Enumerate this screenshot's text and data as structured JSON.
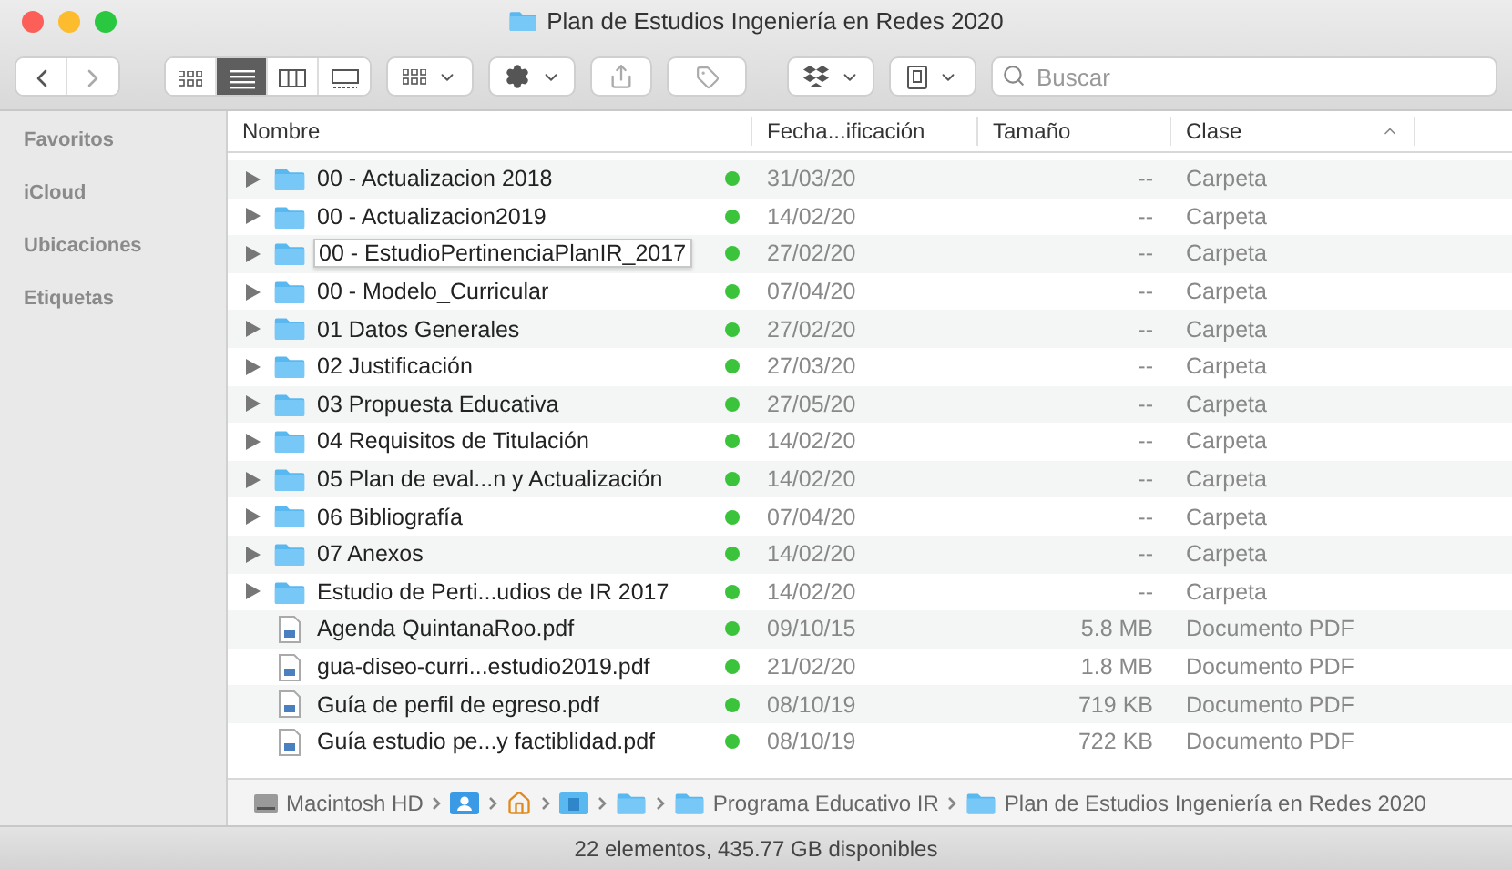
{
  "window": {
    "title": "Plan de Estudios Ingeniería en Redes 2020"
  },
  "toolbar": {
    "view_modes": [
      {
        "kind": "icons",
        "selected": false
      },
      {
        "kind": "list",
        "selected": true
      },
      {
        "kind": "columns",
        "selected": false
      },
      {
        "kind": "gallery",
        "selected": false
      }
    ],
    "search": {
      "placeholder": "Buscar"
    }
  },
  "sidebar": {
    "sections": [
      "Favoritos",
      "iCloud",
      "Ubicaciones",
      "Etiquetas"
    ]
  },
  "table": {
    "columns": [
      {
        "label": "Nombre",
        "sorted": false
      },
      {
        "label": "Fecha...ificación",
        "sorted": false
      },
      {
        "label": "Tamaño",
        "sorted": false
      },
      {
        "label": "Clase",
        "sorted": true
      }
    ],
    "rows": [
      {
        "kind": "folder",
        "name": "00 - Actualizacion 2018",
        "synced": true,
        "date": "31/03/20",
        "size": "--",
        "type": "Carpeta",
        "tooltip": false
      },
      {
        "kind": "folder",
        "name": "00 - Actualizacion2019",
        "synced": true,
        "date": "14/02/20",
        "size": "--",
        "type": "Carpeta",
        "tooltip": false
      },
      {
        "kind": "folder",
        "name": "00 - EstudioPertinenciaPlanIR_2017",
        "synced": true,
        "date": "27/02/20",
        "size": "--",
        "type": "Carpeta",
        "tooltip": true
      },
      {
        "kind": "folder",
        "name": "00 - Modelo_Curricular",
        "synced": true,
        "date": "07/04/20",
        "size": "--",
        "type": "Carpeta",
        "tooltip": false
      },
      {
        "kind": "folder",
        "name": "01 Datos Generales",
        "synced": true,
        "date": "27/02/20",
        "size": "--",
        "type": "Carpeta",
        "tooltip": false
      },
      {
        "kind": "folder",
        "name": "02 Justificación",
        "synced": true,
        "date": "27/03/20",
        "size": "--",
        "type": "Carpeta",
        "tooltip": false
      },
      {
        "kind": "folder",
        "name": "03 Propuesta Educativa",
        "synced": true,
        "date": "27/05/20",
        "size": "--",
        "type": "Carpeta",
        "tooltip": false
      },
      {
        "kind": "folder",
        "name": "04 Requisitos de Titulación",
        "synced": true,
        "date": "14/02/20",
        "size": "--",
        "type": "Carpeta",
        "tooltip": false
      },
      {
        "kind": "folder",
        "name": "05 Plan de eval...n y Actualización",
        "synced": true,
        "date": "14/02/20",
        "size": "--",
        "type": "Carpeta",
        "tooltip": false
      },
      {
        "kind": "folder",
        "name": "06 Bibliografía",
        "synced": true,
        "date": "07/04/20",
        "size": "--",
        "type": "Carpeta",
        "tooltip": false
      },
      {
        "kind": "folder",
        "name": "07 Anexos",
        "synced": true,
        "date": "14/02/20",
        "size": "--",
        "type": "Carpeta",
        "tooltip": false
      },
      {
        "kind": "folder",
        "name": "Estudio de Perti...udios de IR 2017",
        "synced": true,
        "date": "14/02/20",
        "size": "--",
        "type": "Carpeta",
        "tooltip": false
      },
      {
        "kind": "pdf",
        "name": "Agenda QuintanaRoo.pdf",
        "synced": true,
        "date": "09/10/15",
        "size": "5.8 MB",
        "type": "Documento PDF",
        "tooltip": false
      },
      {
        "kind": "pdf",
        "name": "gua-diseo-curri...estudio2019.pdf",
        "synced": true,
        "date": "21/02/20",
        "size": "1.8 MB",
        "type": "Documento PDF",
        "tooltip": false
      },
      {
        "kind": "pdf",
        "name": "Guía de perfil de egreso.pdf",
        "synced": true,
        "date": "08/10/19",
        "size": "719 KB",
        "type": "Documento PDF",
        "tooltip": false
      },
      {
        "kind": "pdf",
        "name": "Guía estudio pe...y factiblidad.pdf",
        "synced": true,
        "date": "08/10/19",
        "size": "722 KB",
        "type": "Documento PDF",
        "tooltip": false
      }
    ]
  },
  "path_bar": [
    {
      "kind": "disk",
      "label": "Macintosh HD"
    },
    {
      "kind": "user"
    },
    {
      "kind": "home"
    },
    {
      "kind": "docs"
    },
    {
      "kind": "folder"
    },
    {
      "kind": "folder",
      "label": "Programa Educativo IR"
    },
    {
      "kind": "folder",
      "label": "Plan de Estudios Ingeniería en Redes 2020"
    }
  ],
  "status_bar": "22 elementos, 435.77 GB disponibles"
}
